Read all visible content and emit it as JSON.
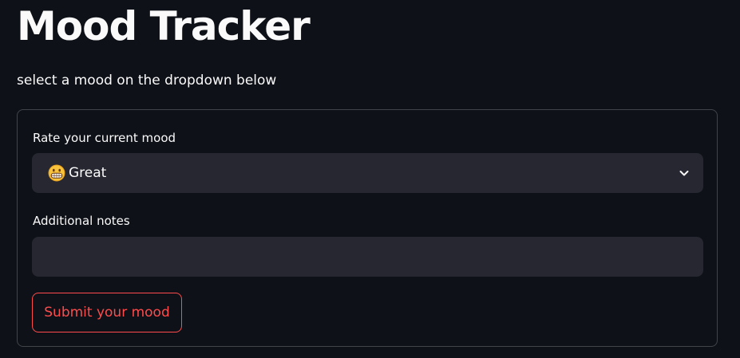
{
  "header": {
    "title": "Mood Tracker",
    "subtitle": "select a mood on the dropdown below"
  },
  "form": {
    "mood_label": "Rate your current mood",
    "mood_select": {
      "selected_icon": "grinning-face-emoji-icon",
      "selected_value": "Great",
      "chevron_icon": "chevron-down-icon"
    },
    "notes_label": "Additional notes",
    "notes_value": "",
    "notes_placeholder": "",
    "submit_label": "Submit your mood"
  },
  "colors": {
    "background": "#0e1117",
    "input_background": "#262730",
    "accent": "#ff4b4b",
    "text": "#fafafa"
  }
}
